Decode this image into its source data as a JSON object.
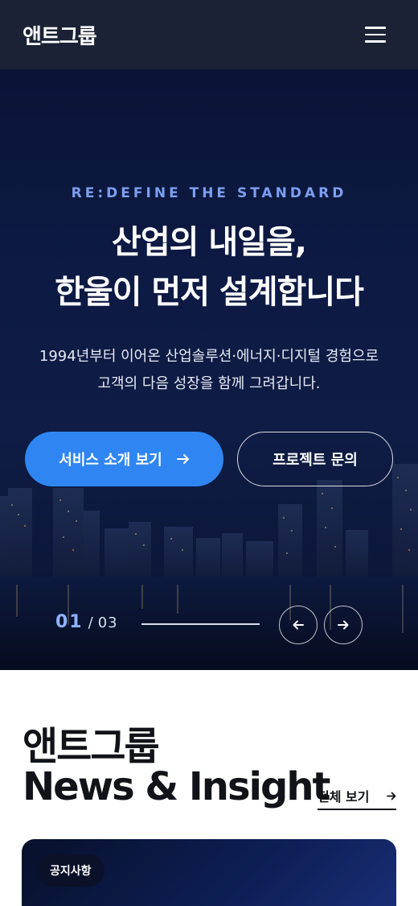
{
  "header": {
    "logo": "앤트그룹",
    "menu_icon": "hamburger-menu-icon"
  },
  "hero": {
    "eyebrow": "RE:DEFINE THE STANDARD",
    "title_line1": "산업의 내일을,",
    "title_line2": "한울이 먼저 설계합니다",
    "desc_line1": "1994년부터 이어온 산업솔루션·에너지·디지털 경험으로",
    "desc_line2": "고객의 다음 성장을 함께 그려갑니다.",
    "primary_button": "서비스 소개 보기",
    "outline_button": "프로젝트 문의",
    "slide_current": "01",
    "slide_separator": "/",
    "slide_total": "03",
    "progress": 1.0
  },
  "news": {
    "title_line1": "앤트그룹",
    "title_line2": "News & Insight",
    "view_all": "전체 보기",
    "card_badge": "공지사항"
  },
  "colors": {
    "header_bg": "#1b2236",
    "accent": "#2f86f2",
    "eyebrow": "#7d9ff0"
  }
}
